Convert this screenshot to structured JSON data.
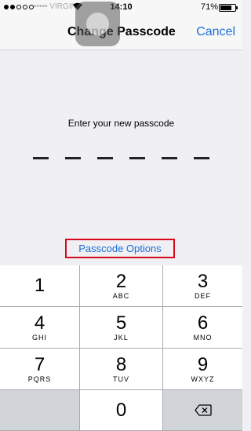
{
  "status": {
    "carrier": "••••• VIRGIN",
    "time": "14:10",
    "battery": "71%",
    "battery_level": 0.71,
    "signal_bars_filled": 2
  },
  "nav": {
    "title": "Change Passcode",
    "cancel": "Cancel"
  },
  "prompt": "Enter your new passcode",
  "passcode_length": 6,
  "options_link": "Passcode Options",
  "keypad": [
    {
      "digit": "1",
      "letters": ""
    },
    {
      "digit": "2",
      "letters": "ABC"
    },
    {
      "digit": "3",
      "letters": "DEF"
    },
    {
      "digit": "4",
      "letters": "GHI"
    },
    {
      "digit": "5",
      "letters": "JKL"
    },
    {
      "digit": "6",
      "letters": "MNO"
    },
    {
      "digit": "7",
      "letters": "PQRS"
    },
    {
      "digit": "8",
      "letters": "TUV"
    },
    {
      "digit": "9",
      "letters": "WXYZ"
    },
    {
      "digit": "0",
      "letters": ""
    }
  ],
  "colors": {
    "accent": "#1a6fd6",
    "highlight_box": "#d8091a",
    "keypad_bg": "#a8abb1"
  },
  "icons": [
    "wifi-icon",
    "battery-icon",
    "delete-backspace-icon",
    "assistive-touch-icon"
  ]
}
